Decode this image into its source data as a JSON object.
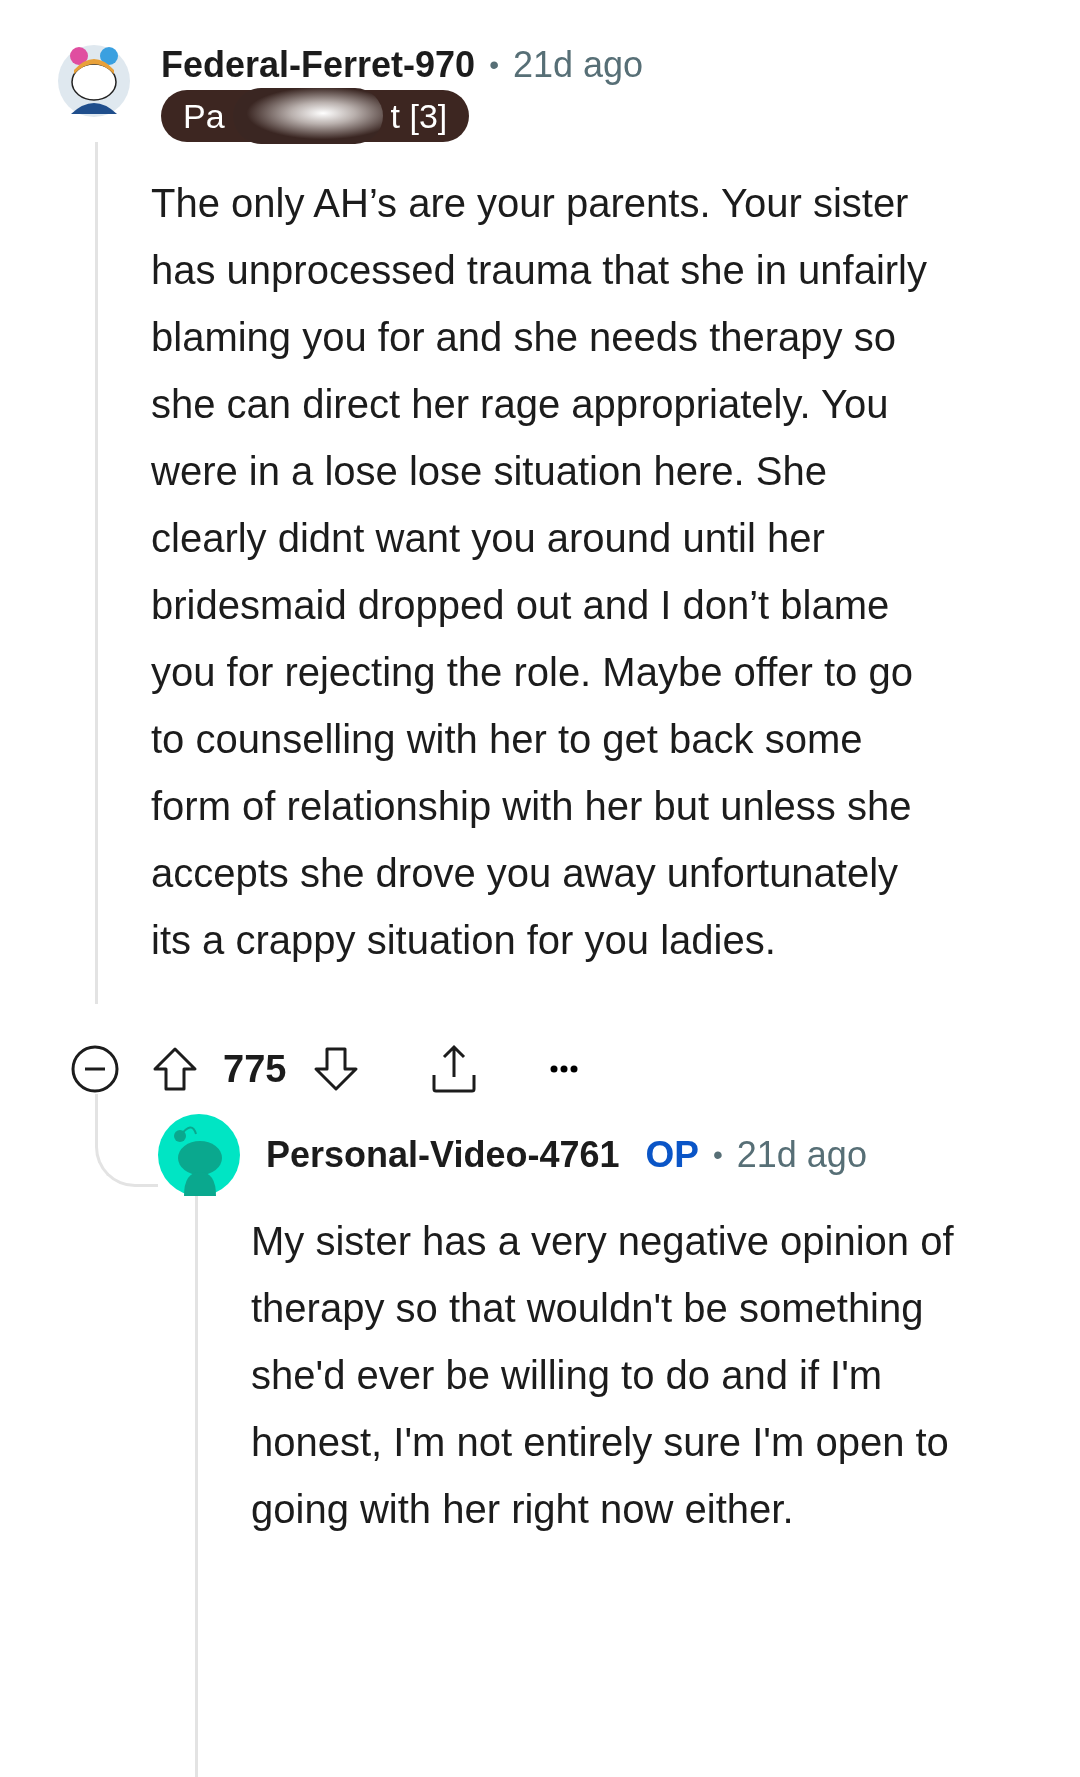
{
  "comment": {
    "author": "Federal-Ferret-970",
    "separator": "•",
    "time": "21d ago",
    "flair": {
      "start": "Pa",
      "end": "t [3]",
      "redacted": true
    },
    "body": "The only AH’s are your parents. Your sister has unprocessed trauma that she in unfairly blaming you for and she needs therapy so she can direct her rage appropriately. You were in a lose lose situation here. She clearly didnt want you around until her bridesmaid dropped out and I don’t blame you for rejecting the role. Maybe offer to go to counselling with her to get back some form of relationship with her but unless she accepts she drove you away unfortunately its a crappy situation for you ladies.",
    "score": "775"
  },
  "reply": {
    "author": "Personal-Video-4761",
    "badge": "OP",
    "separator": "•",
    "time": "21d ago",
    "body": "My sister has a very negative opinion of therapy so that wouldn't be something she'd ever be willing to do and if I'm honest, I'm not entirely sure I'm open to going with her right now either."
  }
}
